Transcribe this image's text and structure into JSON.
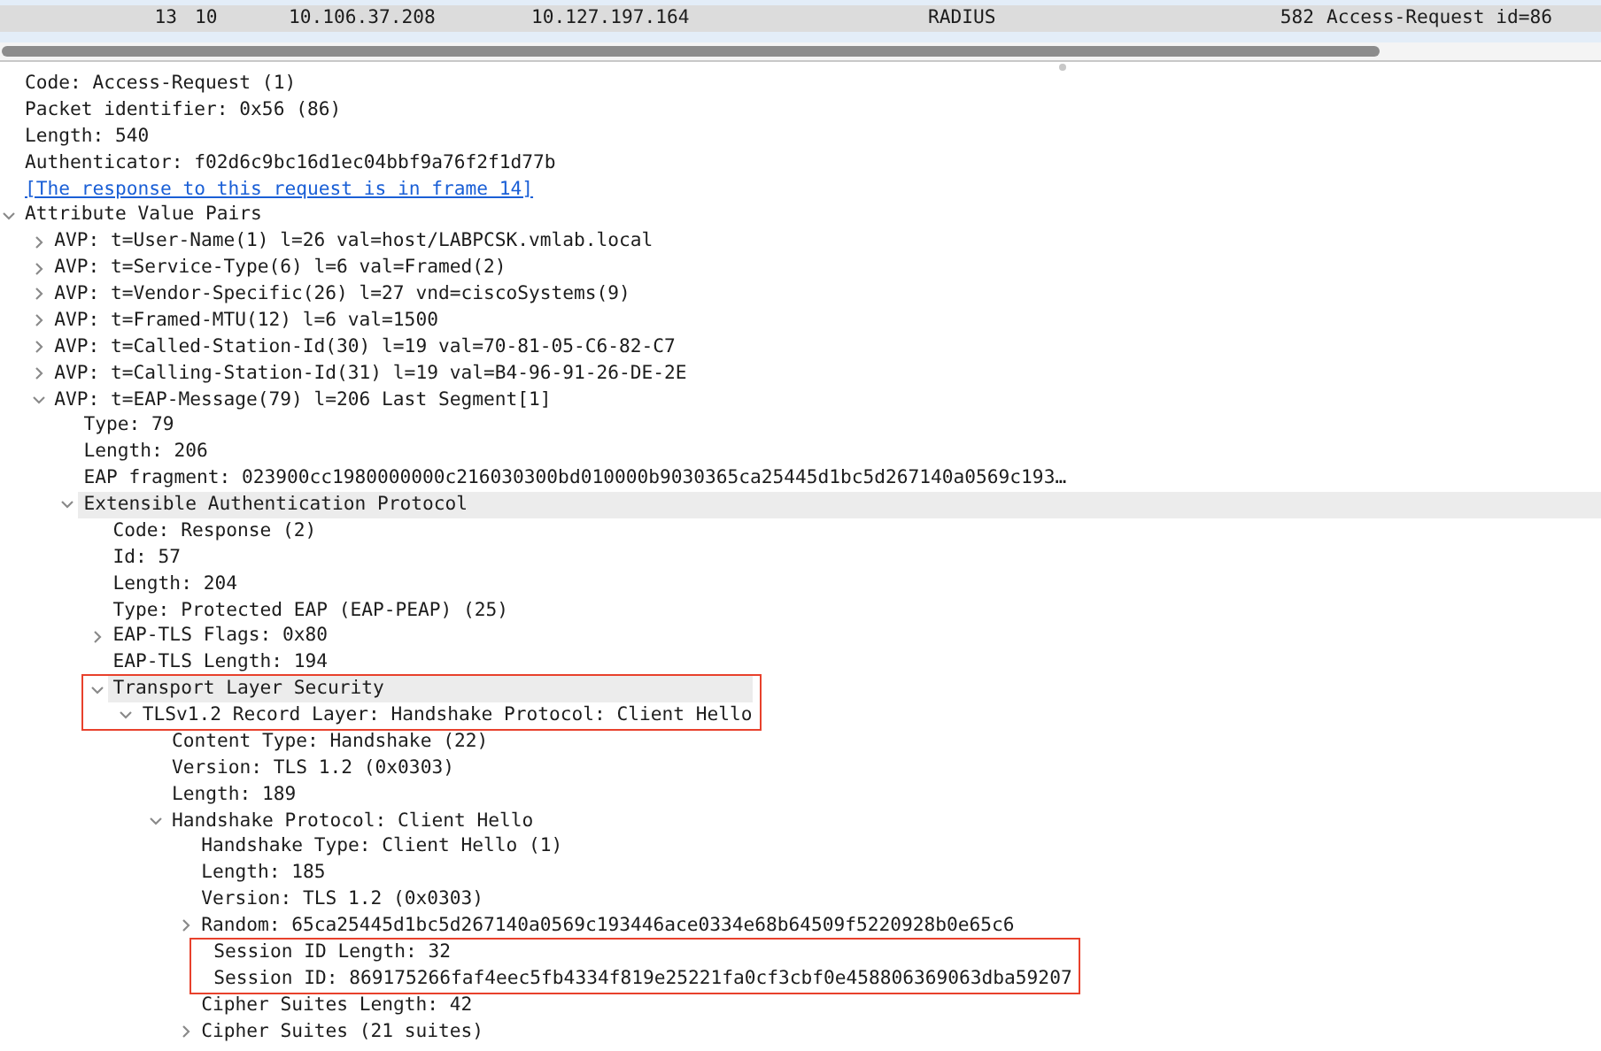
{
  "packet_list": {
    "rows": [
      {
        "no": "13",
        "time": "10",
        "source": "10.106.37.208",
        "destination": "10.127.197.164",
        "protocol": "RADIUS",
        "length": "582",
        "info": "Access-Request id=86",
        "selected": true
      }
    ]
  },
  "details": [
    {
      "text": "Code: Access-Request (1)"
    },
    {
      "text": "Packet identifier: 0x56 (86)"
    },
    {
      "text": "Length: 540"
    },
    {
      "text": "Authenticator: f02d6c9bc16d1ec04bbf9a76f2f1d77b"
    },
    {
      "text": "[The response to this request is in frame 14]",
      "kind": "link"
    },
    {
      "text": "Attribute Value Pairs",
      "expanded": true,
      "children": [
        {
          "text": "AVP: t=User-Name(1) l=26 val=host/LABPCSK.vmlab.local",
          "expanded": false
        },
        {
          "text": "AVP: t=Service-Type(6) l=6 val=Framed(2)",
          "expanded": false
        },
        {
          "text": "AVP: t=Vendor-Specific(26) l=27 vnd=ciscoSystems(9)",
          "expanded": false
        },
        {
          "text": "AVP: t=Framed-MTU(12) l=6 val=1500",
          "expanded": false
        },
        {
          "text": "AVP: t=Called-Station-Id(30) l=19 val=70-81-05-C6-82-C7",
          "expanded": false
        },
        {
          "text": "AVP: t=Calling-Station-Id(31) l=19 val=B4-96-91-26-DE-2E",
          "expanded": false
        },
        {
          "text": "AVP: t=EAP-Message(79) l=206 Last Segment[1]",
          "expanded": true,
          "children": [
            {
              "text": "Type: 79"
            },
            {
              "text": "Length: 206"
            },
            {
              "text": "EAP fragment: 023900cc1980000000c216030300bd010000b9030365ca25445d1bc5d267140a0569c193…"
            },
            {
              "text": "Extensible Authentication Protocol",
              "expanded": true,
              "shaded": true,
              "children": [
                {
                  "text": "Code: Response (2)"
                },
                {
                  "text": "Id: 57"
                },
                {
                  "text": "Length: 204"
                },
                {
                  "text": "Type: Protected EAP (EAP-PEAP) (25)"
                },
                {
                  "text": "EAP-TLS Flags: 0x80",
                  "expanded": false
                },
                {
                  "text": "EAP-TLS Length: 194"
                },
                {
                  "text": "Transport Layer Security",
                  "expanded": true,
                  "shaded": true,
                  "boxed": true,
                  "children": [
                    {
                      "text": "TLSv1.2 Record Layer: Handshake Protocol: Client Hello",
                      "expanded": true,
                      "boxed": true,
                      "children": [
                        {
                          "text": "Content Type: Handshake (22)"
                        },
                        {
                          "text": "Version: TLS 1.2 (0x0303)"
                        },
                        {
                          "text": "Length: 189"
                        },
                        {
                          "text": "Handshake Protocol: Client Hello",
                          "expanded": true,
                          "children": [
                            {
                              "text": "Handshake Type: Client Hello (1)"
                            },
                            {
                              "text": "Length: 185"
                            },
                            {
                              "text": "Version: TLS 1.2 (0x0303)"
                            },
                            {
                              "text": "Random: 65ca25445d1bc5d267140a0569c193446ace0334e68b64509f5220928b0e65c6",
                              "expanded": false
                            },
                            {
                              "text": "Session ID Length: 32",
                              "boxed": true
                            },
                            {
                              "text": "Session ID: 869175266faf4eec5fb4334f819e25221fa0cf3cbf0e458806369063dba59207",
                              "boxed": true
                            },
                            {
                              "text": "Cipher Suites Length: 42"
                            },
                            {
                              "text": "Cipher Suites (21 suites)",
                              "expanded": false
                            }
                          ]
                        }
                      ]
                    }
                  ]
                }
              ]
            }
          ]
        }
      ]
    }
  ]
}
